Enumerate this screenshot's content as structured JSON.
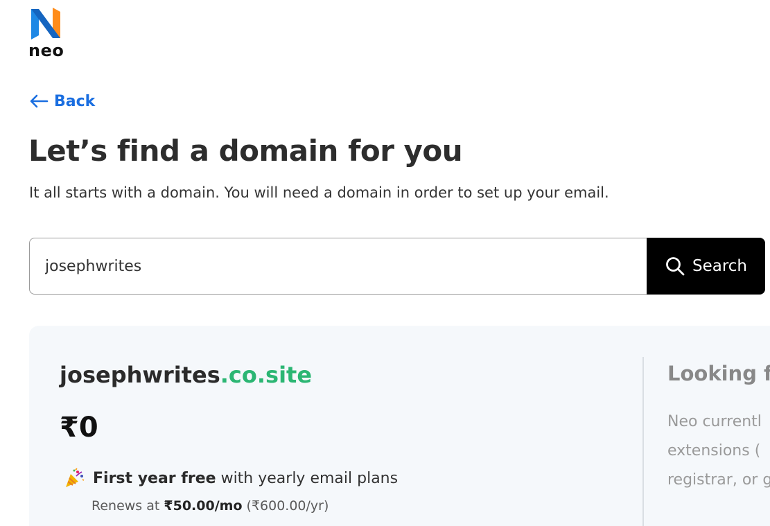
{
  "brand": {
    "name": "neo"
  },
  "nav": {
    "back_label": "Back"
  },
  "page": {
    "title": "Let’s find a domain for you",
    "subtitle": "It all starts with a domain. You will need a domain in order to set up your email."
  },
  "search": {
    "value": "josephwrites",
    "button_label": "Search"
  },
  "result": {
    "domain_name": "josephwrites",
    "domain_extension": ".co.site",
    "price": "₹0",
    "promo_strong": "First year free",
    "promo_rest": " with yearly email plans",
    "renews_prefix": "Renews at ",
    "renews_monthly": "₹50.00/mo",
    "renews_yearly": " (₹600.00/yr)"
  },
  "side_panel": {
    "title": "Looking fo",
    "lines": [
      "Neo currentl",
      "extensions (",
      "registrar, or g"
    ]
  },
  "colors": {
    "accent_blue": "#1a6ee0",
    "extension_green": "#2bb673",
    "search_button": "#000000",
    "card_bg": "#f5f8fb"
  },
  "icons": [
    "neo-logo",
    "arrow-left-icon",
    "search-icon",
    "party-popper-icon"
  ]
}
